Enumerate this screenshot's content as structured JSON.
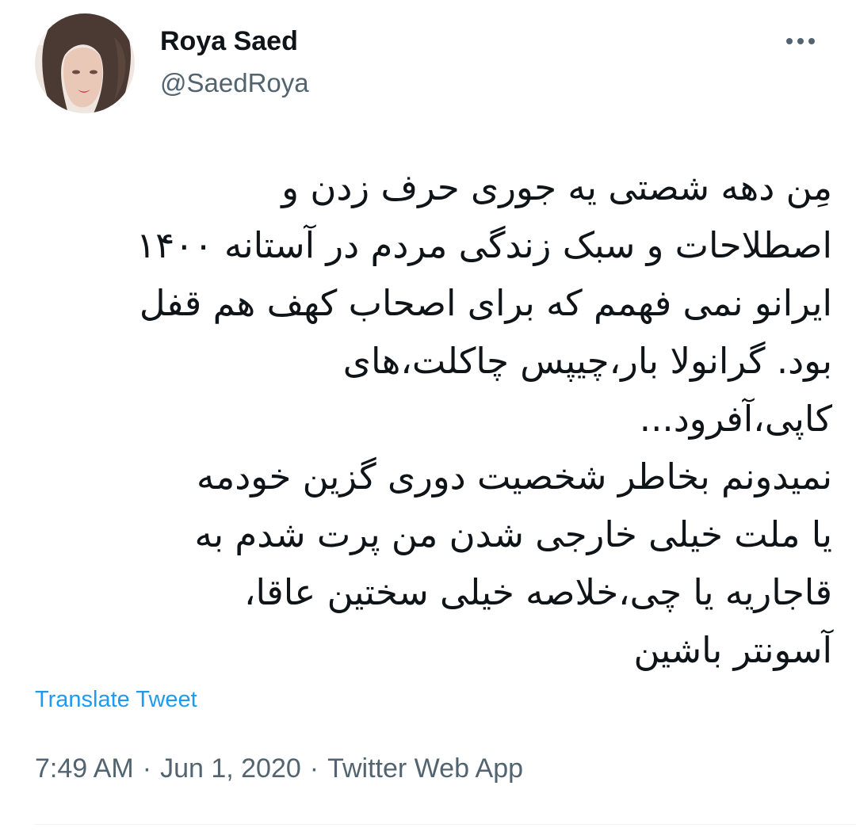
{
  "author": {
    "name": "Roya Saed",
    "handle": "@SaedRoya",
    "avatar_icon": "profile-photo"
  },
  "more_icon": "more-horizontal-icon",
  "tweet": {
    "lines": [
      "مِن دهه شصتی یه جوری حرف زدن و",
      "اصطلاحات و سبک زندگی مردم در آستانه ۱۴۰۰",
      "ایرانو نمی فهمم که برای اصحاب کهف هم قفل",
      "بود. گرانولا بار،چیپس چاکلت،های",
      "کاپی،آفرود...",
      "نمیدونم بخاطر شخصیت دوری گزین خودمه",
      "یا ملت خیلی خارجی شدن من پرت شدم به",
      "قاجاریه یا چی،خلاصه خیلی سختین عاقا،",
      "آسونتر باشین"
    ]
  },
  "translate_label": "Translate Tweet",
  "meta": {
    "time": "7:49 AM",
    "date": "Jun 1, 2020",
    "source": "Twitter Web App",
    "separator": "·"
  },
  "colors": {
    "text": "#0f1419",
    "secondary": "#536471",
    "link": "#1d9bf0",
    "divider": "#eff3f4"
  }
}
